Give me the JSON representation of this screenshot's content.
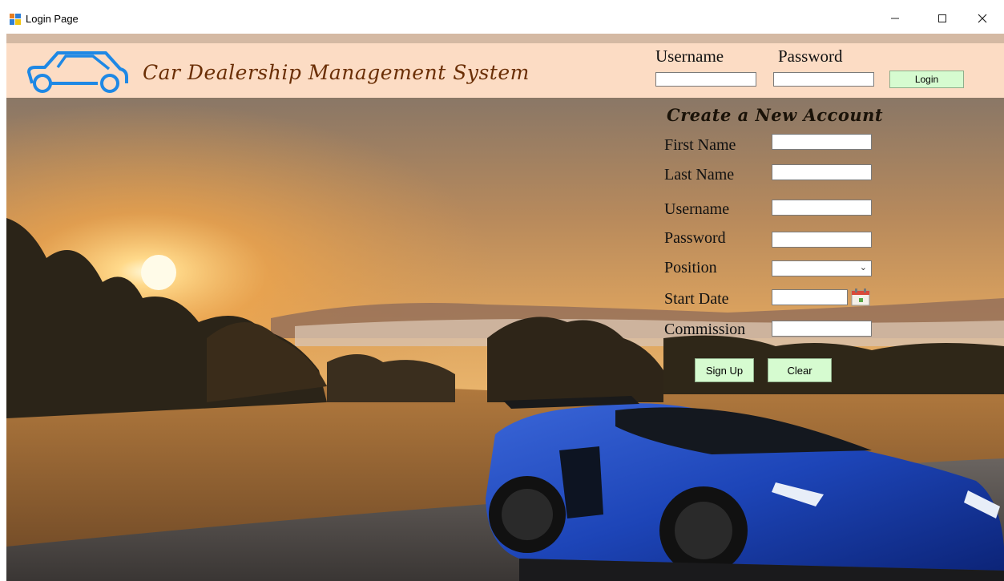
{
  "window": {
    "title": "Login Page",
    "minimize_icon": "minimize-icon",
    "maximize_icon": "maximize-icon",
    "close_icon": "close-icon"
  },
  "header": {
    "app_title": "Car Dealership Management System",
    "logo_icon": "car-outline-icon",
    "username_label": "Username",
    "username_value": "",
    "password_label": "Password",
    "password_value": "",
    "login_label": "Login"
  },
  "signup": {
    "title": "Create a New Account",
    "fields": [
      {
        "label": "First Name",
        "value": ""
      },
      {
        "label": "Last Name",
        "value": ""
      },
      {
        "label": "Username",
        "value": ""
      },
      {
        "label": "Password",
        "value": ""
      },
      {
        "label": "Position",
        "value": ""
      },
      {
        "label": "Start Date",
        "value": ""
      },
      {
        "label": "Commission",
        "value": ""
      }
    ],
    "calendar_icon": "calendar-icon",
    "signup_label": "Sign Up",
    "clear_label": "Clear"
  },
  "colors": {
    "header_band": "#fcdcc4",
    "title_text": "#6a2e05",
    "logo_stroke": "#1e88e5",
    "button_fill": "#d6fbd0"
  }
}
